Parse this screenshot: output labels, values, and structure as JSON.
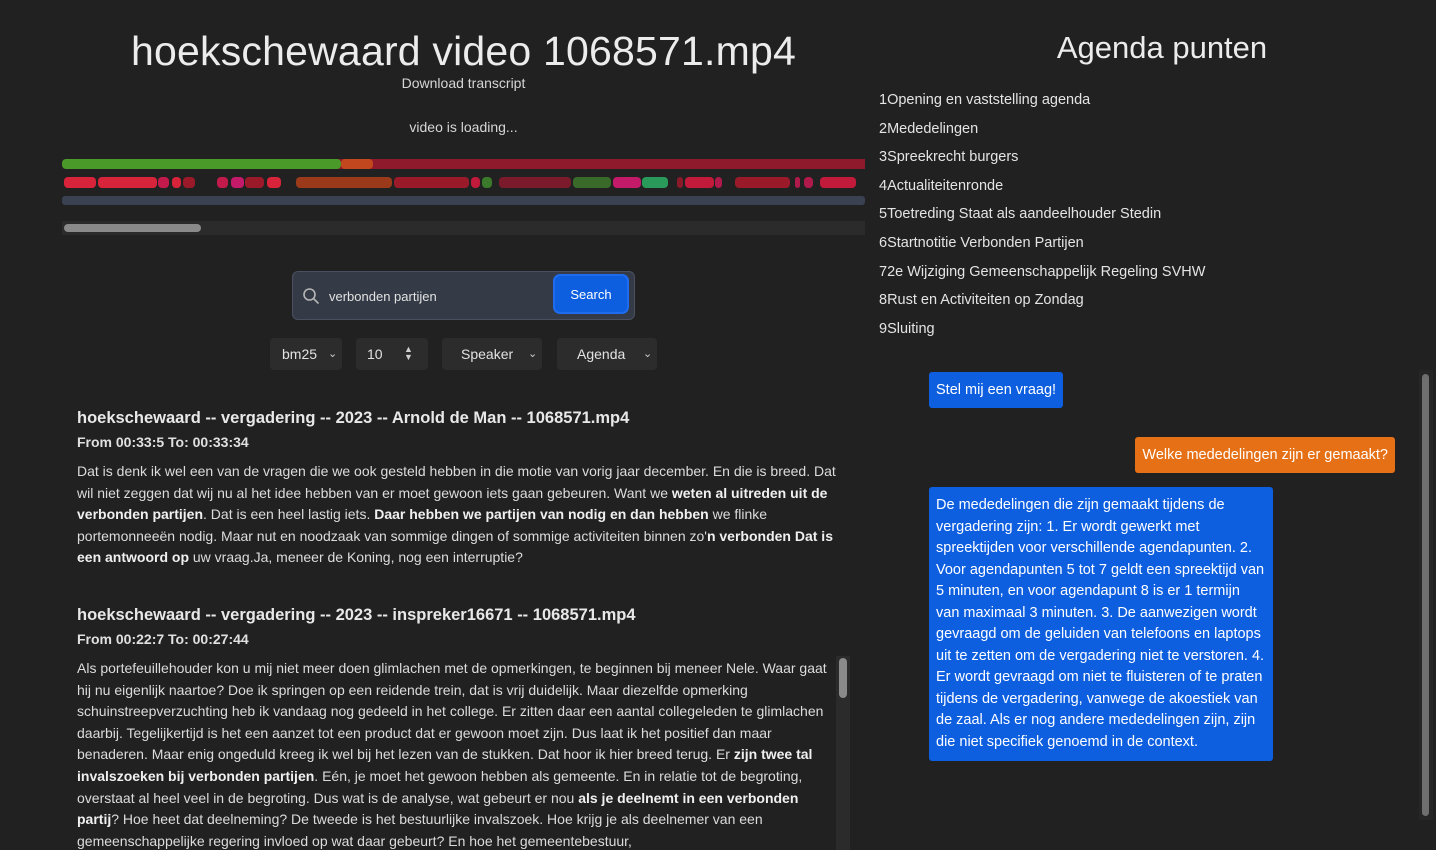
{
  "header": {
    "title": "hoekschewaard video 1068571.mp4",
    "download_label": "Download transcript",
    "loading_text": "video is loading..."
  },
  "timeline": {
    "track1": [
      {
        "color": "#4a9a2a"
      },
      {
        "color": "#c2471f"
      },
      {
        "color": "#8e1a2b"
      }
    ],
    "track2": [
      {
        "color": "#d8243a"
      },
      {
        "color": "#d8243a"
      },
      {
        "color": "#c21a4a"
      },
      {
        "color": "#d8243a"
      },
      {
        "color": "#9b1a2a"
      },
      {
        "color": "#c21a4a"
      },
      {
        "color": "#c41a6a"
      },
      {
        "color": "#9b1a2a"
      },
      {
        "color": "#d8243a"
      },
      {
        "color": "#9a3a1a"
      },
      {
        "color": "#9b1a2a"
      },
      {
        "color": "#c21a3a"
      },
      {
        "color": "#3a7a2a"
      },
      {
        "color": "#7a1a2a"
      },
      {
        "color": "#3a6a2a"
      },
      {
        "color": "#c41a6a"
      },
      {
        "color": "#2a9a5a"
      },
      {
        "color": "#8a1a2a"
      },
      {
        "color": "#c21a3a"
      },
      {
        "color": "#b01a4a"
      },
      {
        "color": "#9b1a2a"
      },
      {
        "color": "#b01a4a"
      },
      {
        "color": "#b01a4a"
      },
      {
        "color": "#c21a3a"
      }
    ]
  },
  "search": {
    "value": "verbonden partijen",
    "button_label": "Search",
    "icon": "search-icon"
  },
  "filters": {
    "method": "bm25",
    "count": "10",
    "speaker": "Speaker",
    "agenda": "Agenda"
  },
  "results": [
    {
      "title": "hoekschewaard -- vergadering -- 2023 -- Arnold de Man -- 1068571.mp4",
      "time": "From 00:33:5 To: 00:33:34",
      "parts": [
        {
          "t": "Dat is denk ik wel een van de vragen die we ook gesteld hebben in die motie van vorig jaar december. En die is breed. Dat wil niet zeggen dat wij nu al het idee hebben van er moet gewoon iets gaan gebeuren. Want we ",
          "b": false
        },
        {
          "t": "weten al uitreden uit de verbonden partijen",
          "b": true
        },
        {
          "t": ". Dat is een heel lastig iets. ",
          "b": false
        },
        {
          "t": "Daar hebben we partijen van nodig en dan hebben",
          "b": true
        },
        {
          "t": " we flinke portemonneeën nodig. Maar nut en noodzaak van sommige dingen of sommige activiteiten binnen zo'",
          "b": false
        },
        {
          "t": "n verbonden Dat is een antwoord op",
          "b": true
        },
        {
          "t": " uw vraag.Ja, meneer de Koning, nog een interruptie?",
          "b": false
        }
      ]
    },
    {
      "title": "hoekschewaard -- vergadering -- 2023 -- inspreker16671 -- 1068571.mp4",
      "time": "From 00:22:7 To: 00:27:44",
      "parts": [
        {
          "t": "Als portefeuillehouder kon u mij niet meer doen glimlachen met de opmerkingen, te beginnen bij meneer Nele. Waar gaat hij nu eigenlijk naartoe? Doe ik springen op een reidende trein, dat is vrij duidelijk. Maar diezelfde opmerking schuinstreepverzuchting heb ik vandaag nog gedeeld in het college. Er zitten daar een aantal collegeleden te glimlachen daarbij. Tegelijkertijd is het een aanzet tot een product dat er gewoon moet zijn. Dus laat ik het positief dan maar benaderen. Maar enig ongeduld kreeg ik wel bij het lezen van de stukken. Dat hoor ik hier breed terug. Er ",
          "b": false
        },
        {
          "t": "zijn twee tal invalszoeken bij verbonden partijen",
          "b": true
        },
        {
          "t": ". Eén, je moet het gewoon hebben als gemeente. En in relatie tot de begroting, overstaat al heel veel in de begroting. Dus wat is de analyse, wat gebeurt er nou ",
          "b": false
        },
        {
          "t": "als je deelnemt in een verbonden partij",
          "b": true
        },
        {
          "t": "? Hoe heet dat deelneming? De tweede is het bestuurlijke invalszoek. Hoe krijg je als deelnemer van een gemeenschappelijke regering invloed op wat daar gebeurt? En hoe het gemeentebestuur,",
          "b": false
        }
      ]
    }
  ],
  "agenda": {
    "title": "Agenda punten",
    "items": [
      "1Opening en vaststelling agenda",
      "2Mededelingen",
      "3Spreekrecht burgers",
      "4Actualiteitenronde",
      "5Toetreding Staat als aandeelhouder Stedin",
      "6Startnotitie Verbonden Partijen",
      "72e Wijziging Gemeenschappelijk Regeling SVHW",
      "8Rust en Activiteiten op Zondag",
      "9Sluiting"
    ]
  },
  "chat": {
    "prompt": "Stel mij een vraag!",
    "question": "Welke mededelingen zijn er gemaakt?",
    "answer": "De mededelingen die zijn gemaakt tijdens de vergadering zijn: 1. Er wordt gewerkt met spreektijden voor verschillende agendapunten. 2. Voor agendapunten 5 tot 7 geldt een spreektijd van 5 minuten, en voor agendapunt 8 is er 1 termijn van maximaal 3 minuten. 3. De aanwezigen wordt gevraagd om de geluiden van telefoons en laptops uit te zetten om de vergadering niet te verstoren. 4. Er wordt gevraagd om niet te fluisteren of te praten tijdens de vergadering, vanwege de akoestiek van de zaal. Als er nog andere mededelingen zijn, zijn die niet specifiek genoemd in de context.",
    "colors": {
      "assistant": "#0d5fe0",
      "user": "#e67015"
    }
  }
}
